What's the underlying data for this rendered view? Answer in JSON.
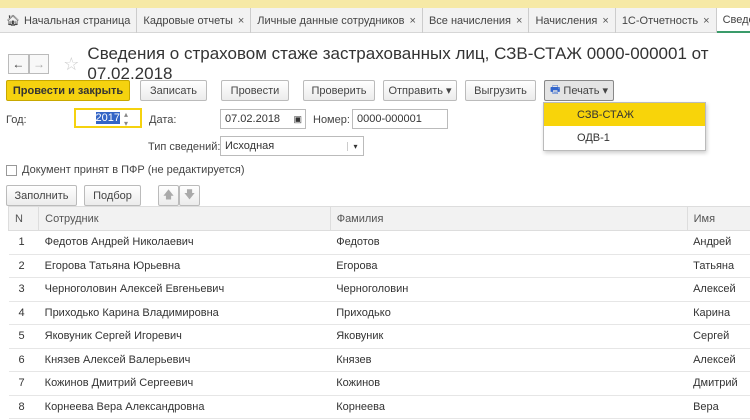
{
  "tabs": [
    {
      "label": "Начальная страница",
      "closable": false
    },
    {
      "label": "Кадровые отчеты",
      "closable": true
    },
    {
      "label": "Личные данные сотрудников",
      "closable": true
    },
    {
      "label": "Все начисления",
      "closable": true
    },
    {
      "label": "Начисления",
      "closable": true
    },
    {
      "label": "1С-Отчетность",
      "closable": true
    },
    {
      "label": "Сведения",
      "closable": false
    }
  ],
  "header": {
    "title": "Сведения о страховом стаже застрахованных лиц, СЗВ-СТАЖ 0000-000001 от 07.02.2018"
  },
  "toolbar": {
    "post_close": "Провести и закрыть",
    "save": "Записать",
    "post": "Провести",
    "check": "Проверить",
    "send": "Отправить",
    "export": "Выгрузить",
    "print": "Печать"
  },
  "print_menu": [
    "СЗВ-СТАЖ",
    "ОДВ-1"
  ],
  "form": {
    "year_label": "Год:",
    "year": "2017",
    "date_label": "Дата:",
    "date": "07.02.2018",
    "number_label": "Номер:",
    "number": "0000-000001",
    "type_label": "Тип сведений:",
    "type": "Исходная",
    "accepted_label": "Документ принят в ПФР (не редактируется)"
  },
  "table_toolbar": {
    "fill": "Заполнить",
    "pick": "Подбор"
  },
  "table": {
    "columns": [
      "N",
      "Сотрудник",
      "Фамилия",
      "Имя"
    ],
    "rows": [
      [
        "1",
        "Федотов Андрей Николаевич",
        "Федотов",
        "Андрей"
      ],
      [
        "2",
        "Егорова Татьяна Юрьевна",
        "Егорова",
        "Татьяна"
      ],
      [
        "3",
        "Черноголовин Алексей Евгеньевич",
        "Черноголовин",
        "Алексей"
      ],
      [
        "4",
        "Приходько Карина Владимировна",
        "Приходько",
        "Карина"
      ],
      [
        "5",
        "Яковуник Сергей Игоревич",
        "Яковуник",
        "Сергей"
      ],
      [
        "6",
        "Князев Алексей Валерьевич",
        "Князев",
        "Алексей"
      ],
      [
        "7",
        "Кожинов Дмитрий Сергеевич",
        "Кожинов",
        "Дмитрий"
      ],
      [
        "8",
        "Корнеева Вера Александровна",
        "Корнеева",
        "Вера"
      ]
    ]
  },
  "colors": {
    "accent": "#f5d20f",
    "active_tab": "#3a9b6a"
  }
}
